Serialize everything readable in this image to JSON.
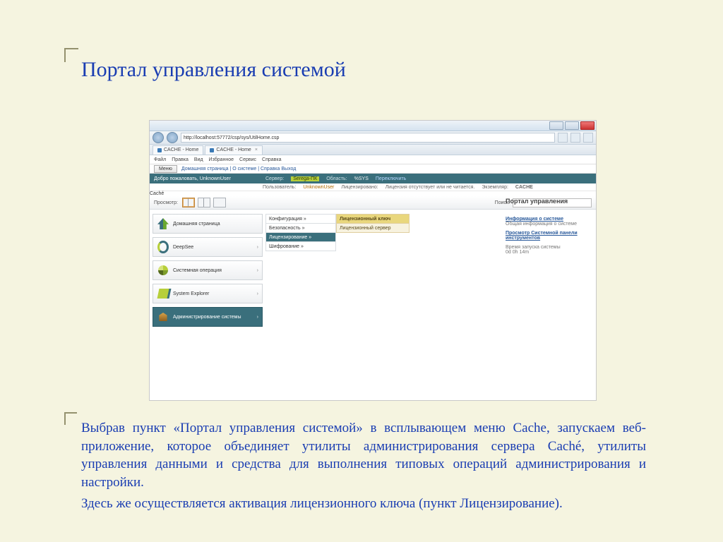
{
  "slide": {
    "title": "Портал управления системой",
    "p1": "Выбрав пункт «Портал управления системой» в всплывающем меню Cache, запускаем веб-приложение, которое объединяет утилиты администрирования сервера Caché, утилиты управления данными и средства для выполнения типовых операций администрирования и настройки.",
    "p2": "Здесь же осуществляется активация лицензионного ключа (пункт Лицензирование)."
  },
  "browser": {
    "url": "http://localhost:57772/csp/sys/UtilHome.csp",
    "tabs": [
      "CACHE - Home",
      "CACHE - Home"
    ],
    "menubar": [
      "Файл",
      "Правка",
      "Вид",
      "Избранное",
      "Сервис",
      "Справка"
    ]
  },
  "header": {
    "menu_btn": "Меню",
    "breadcrumb": "Домашняя страница | О системе | Справка Выход",
    "welcome": "Добро пожаловать, UnknownUser",
    "server_lbl": "Сервер:",
    "server": "Serega-ПК",
    "user_lbl": "Пользователь:",
    "user": "UnknownUser",
    "ns_lbl": "Область:",
    "ns": "%SYS",
    "switch": "Переключить",
    "lic_lbl": "Лицензировано:",
    "lic": "Лицензия отсутствует или не читается.",
    "inst_lbl": "Экземпляр:",
    "inst": "CACHE",
    "logo": "Caché"
  },
  "viewrow": {
    "view_lbl": "Просмотр:",
    "search_lbl": "Поиск:",
    "portal": "Портал управления"
  },
  "sidebar": [
    "Домашняя страница",
    "DeepSee",
    "Системная операция",
    "System Explorer",
    "Администрирование системы"
  ],
  "submenu": [
    "Конфигурация »",
    "Безопасность »",
    "Лицензирование »",
    "Шифрование »"
  ],
  "submenu2": [
    "Лицензионный ключ",
    "Лицензионный сервер"
  ],
  "rightcol": {
    "l1": "Информация о системе",
    "s1": "Общая информация о системе",
    "l2": "Просмотр Системной панели инструментов",
    "t_lbl": "Время запуска системы",
    "t": "0d 0h 14m"
  }
}
